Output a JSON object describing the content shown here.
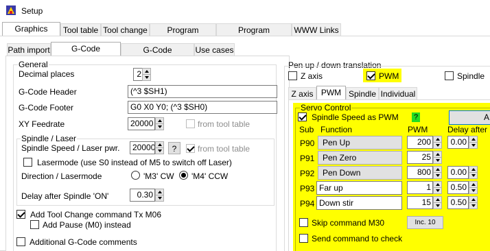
{
  "window": {
    "title": "Setup"
  },
  "main_tabs": [
    "Graphics import",
    "Tool table",
    "Tool change",
    "Program behavior",
    "Program appearance",
    "WWW Links"
  ],
  "sub_tabs": [
    "Path import",
    "G-Code generation",
    "G-Code modification",
    "Use cases"
  ],
  "general": {
    "group_label": "General",
    "decimal_places_label": "Decimal places",
    "decimal_places_value": "2",
    "header_label": "G-Code Header",
    "header_value": "(^3 $SH1)",
    "footer_label": "G-Code Footer",
    "footer_value": "G0 X0 Y0; (^3 $SH0)",
    "feedrate_label": "XY Feedrate",
    "feedrate_value": "20000",
    "feedrate_from_tool": "from tool table"
  },
  "spindle": {
    "group_label": "Spindle / Laser",
    "speed_label": "Spindle Speed / Laser pwr.",
    "speed_value": "20000",
    "help_label": "?",
    "speed_from_tool": "from tool table",
    "lasermode_label": "Lasermode (use S0 instead of M5 to switch off Laser)",
    "direction_label": "Direction / Lasermode",
    "m3_label": "'M3' CW",
    "m4_label": "'M4' CCW",
    "delay_label": "Delay after Spindle 'ON'",
    "delay_value": "0.30"
  },
  "toolchange": {
    "label": "Add Tool Change command Tx M06",
    "pause_label": "Add Pause (M0) instead"
  },
  "additional_comments": "Additional G-Code comments",
  "penupdown": {
    "group_label": "Pen up / down translation",
    "z_axis": "Z axis",
    "pwm": "PWM",
    "spindle": "Spindle",
    "tabs": [
      "Z axis",
      "PWM",
      "Spindle",
      "Individual"
    ]
  },
  "servo": {
    "group_label": "Servo Control",
    "spindle_as_pwm": "Spindle Speed as PWM",
    "help_label": "?",
    "apply_label": "A",
    "col_sub": "Sub",
    "col_function": "Function",
    "col_pwm": "PWM",
    "col_delay": "Delay after",
    "rows": [
      {
        "sub": "P90",
        "function": "Pen Up",
        "pwm": "200",
        "delay": "0.00",
        "editable": false
      },
      {
        "sub": "P91",
        "function": "Pen Zero",
        "pwm": "25",
        "delay": "",
        "editable": false
      },
      {
        "sub": "P92",
        "function": "Pen Down",
        "pwm": "800",
        "delay": "0.00",
        "editable": false
      },
      {
        "sub": "P93",
        "function": "Far up",
        "pwm": "1",
        "delay": "0.50",
        "editable": true
      },
      {
        "sub": "P94",
        "function": "Down stir",
        "pwm": "15",
        "delay": "0.50",
        "editable": true
      }
    ],
    "skip_m30": "Skip command M30",
    "inc_button": "Inc. 10",
    "send_command": "Send command to check"
  },
  "colors": {
    "highlight": "#ffff00",
    "help_green": "#22dd22",
    "app_icon": "#3a3aa8"
  }
}
